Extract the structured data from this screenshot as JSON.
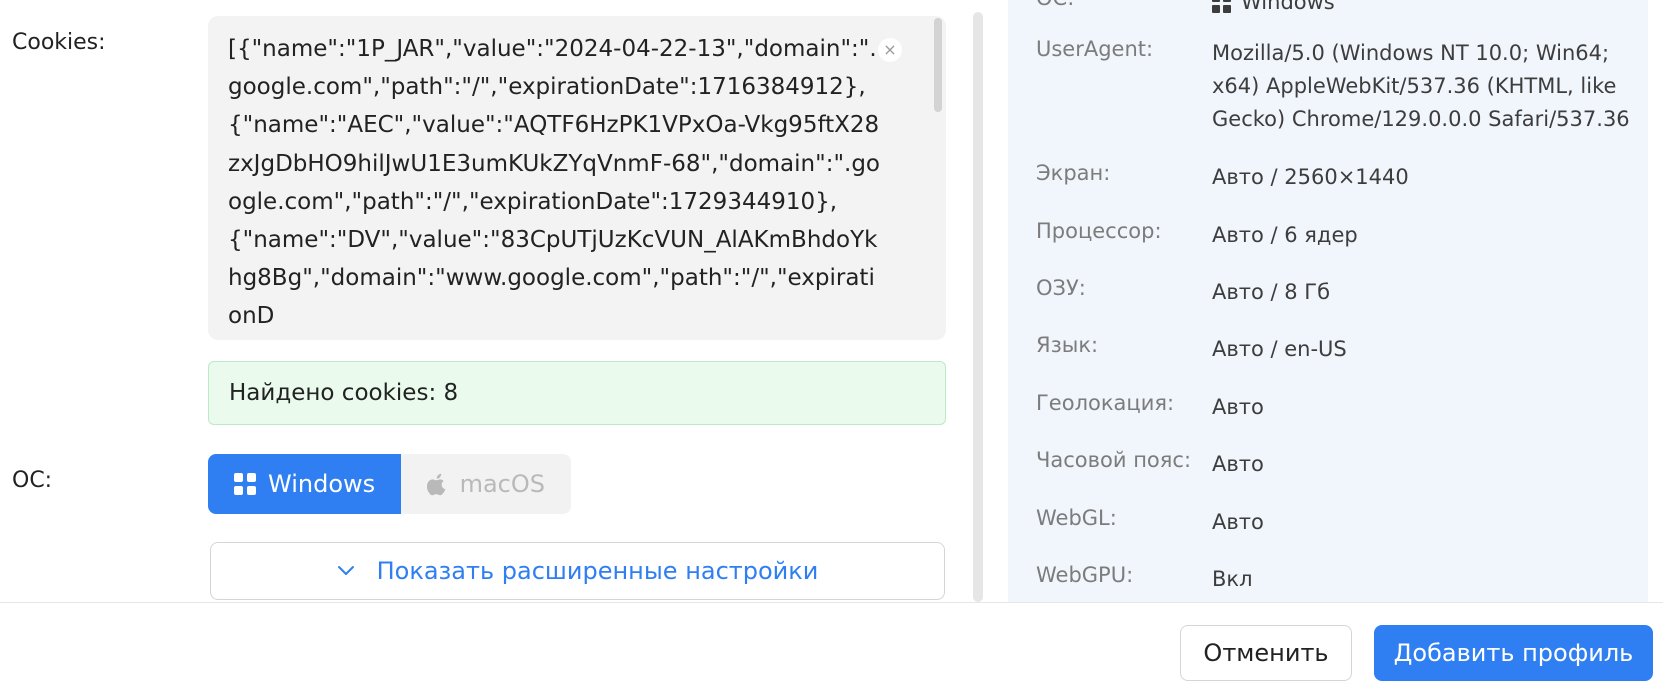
{
  "form": {
    "cookies_label": "Cookies:",
    "cookies_value": "[{\"name\":\"1P_JAR\",\"value\":\"2024-04-22-13\",\"domain\":\".google.com\",\"path\":\"/\",\"expirationDate\":1716384912},{\"name\":\"AEC\",\"value\":\"AQTF6HzPK1VPxOa-Vkg95ftX28zxJgDbHO9hilJwU1E3umKUkZYqVnmF-68\",\"domain\":\".google.com\",\"path\":\"/\",\"expirationDate\":1729344910},\n{\"name\":\"DV\",\"value\":\"83CpUTjUzKcVUN_AlAKmBhdoYkhg8Bg\",\"domain\":\"www.google.com\",\"path\":\"/\",\"expirationD",
    "clear_icon": "×",
    "found_text": "Найдено cookies: 8",
    "os_label": "ОС:",
    "os_options": [
      {
        "label": "Windows",
        "icon": "windows-icon",
        "selected": true
      },
      {
        "label": "macOS",
        "icon": "apple-icon",
        "selected": false
      }
    ],
    "advanced_label": "Показать расширенные настройки"
  },
  "summary": {
    "os_key": "ОС:",
    "os_value": "Windows",
    "rows": [
      {
        "key": "UserAgent:",
        "value": "Mozilla/5.0 (Windows NT 10.0; Win64; x64) AppleWebKit/537.36 (KHTML, like Gecko) Chrome/129.0.0.0 Safari/537.36"
      },
      {
        "key": "Экран:",
        "value": "Авто / 2560×1440"
      },
      {
        "key": "Процессор:",
        "value": "Авто / 6 ядер"
      },
      {
        "key": "ОЗУ:",
        "value": "Авто / 8 Гб"
      },
      {
        "key": "Язык:",
        "value": "Авто / en-US"
      },
      {
        "key": "Геолокация:",
        "value": "Авто"
      },
      {
        "key": "Часовой пояс:",
        "value": "Авто"
      },
      {
        "key": "WebGL:",
        "value": "Авто"
      },
      {
        "key": "WebGPU:",
        "value": "Вкл"
      }
    ]
  },
  "footer": {
    "cancel_label": "Отменить",
    "add_label": "Добавить профиль"
  },
  "colors": {
    "accent": "#2f7ff2",
    "success_bg": "#eafbee",
    "panel_bg": "#f1f5fc"
  }
}
